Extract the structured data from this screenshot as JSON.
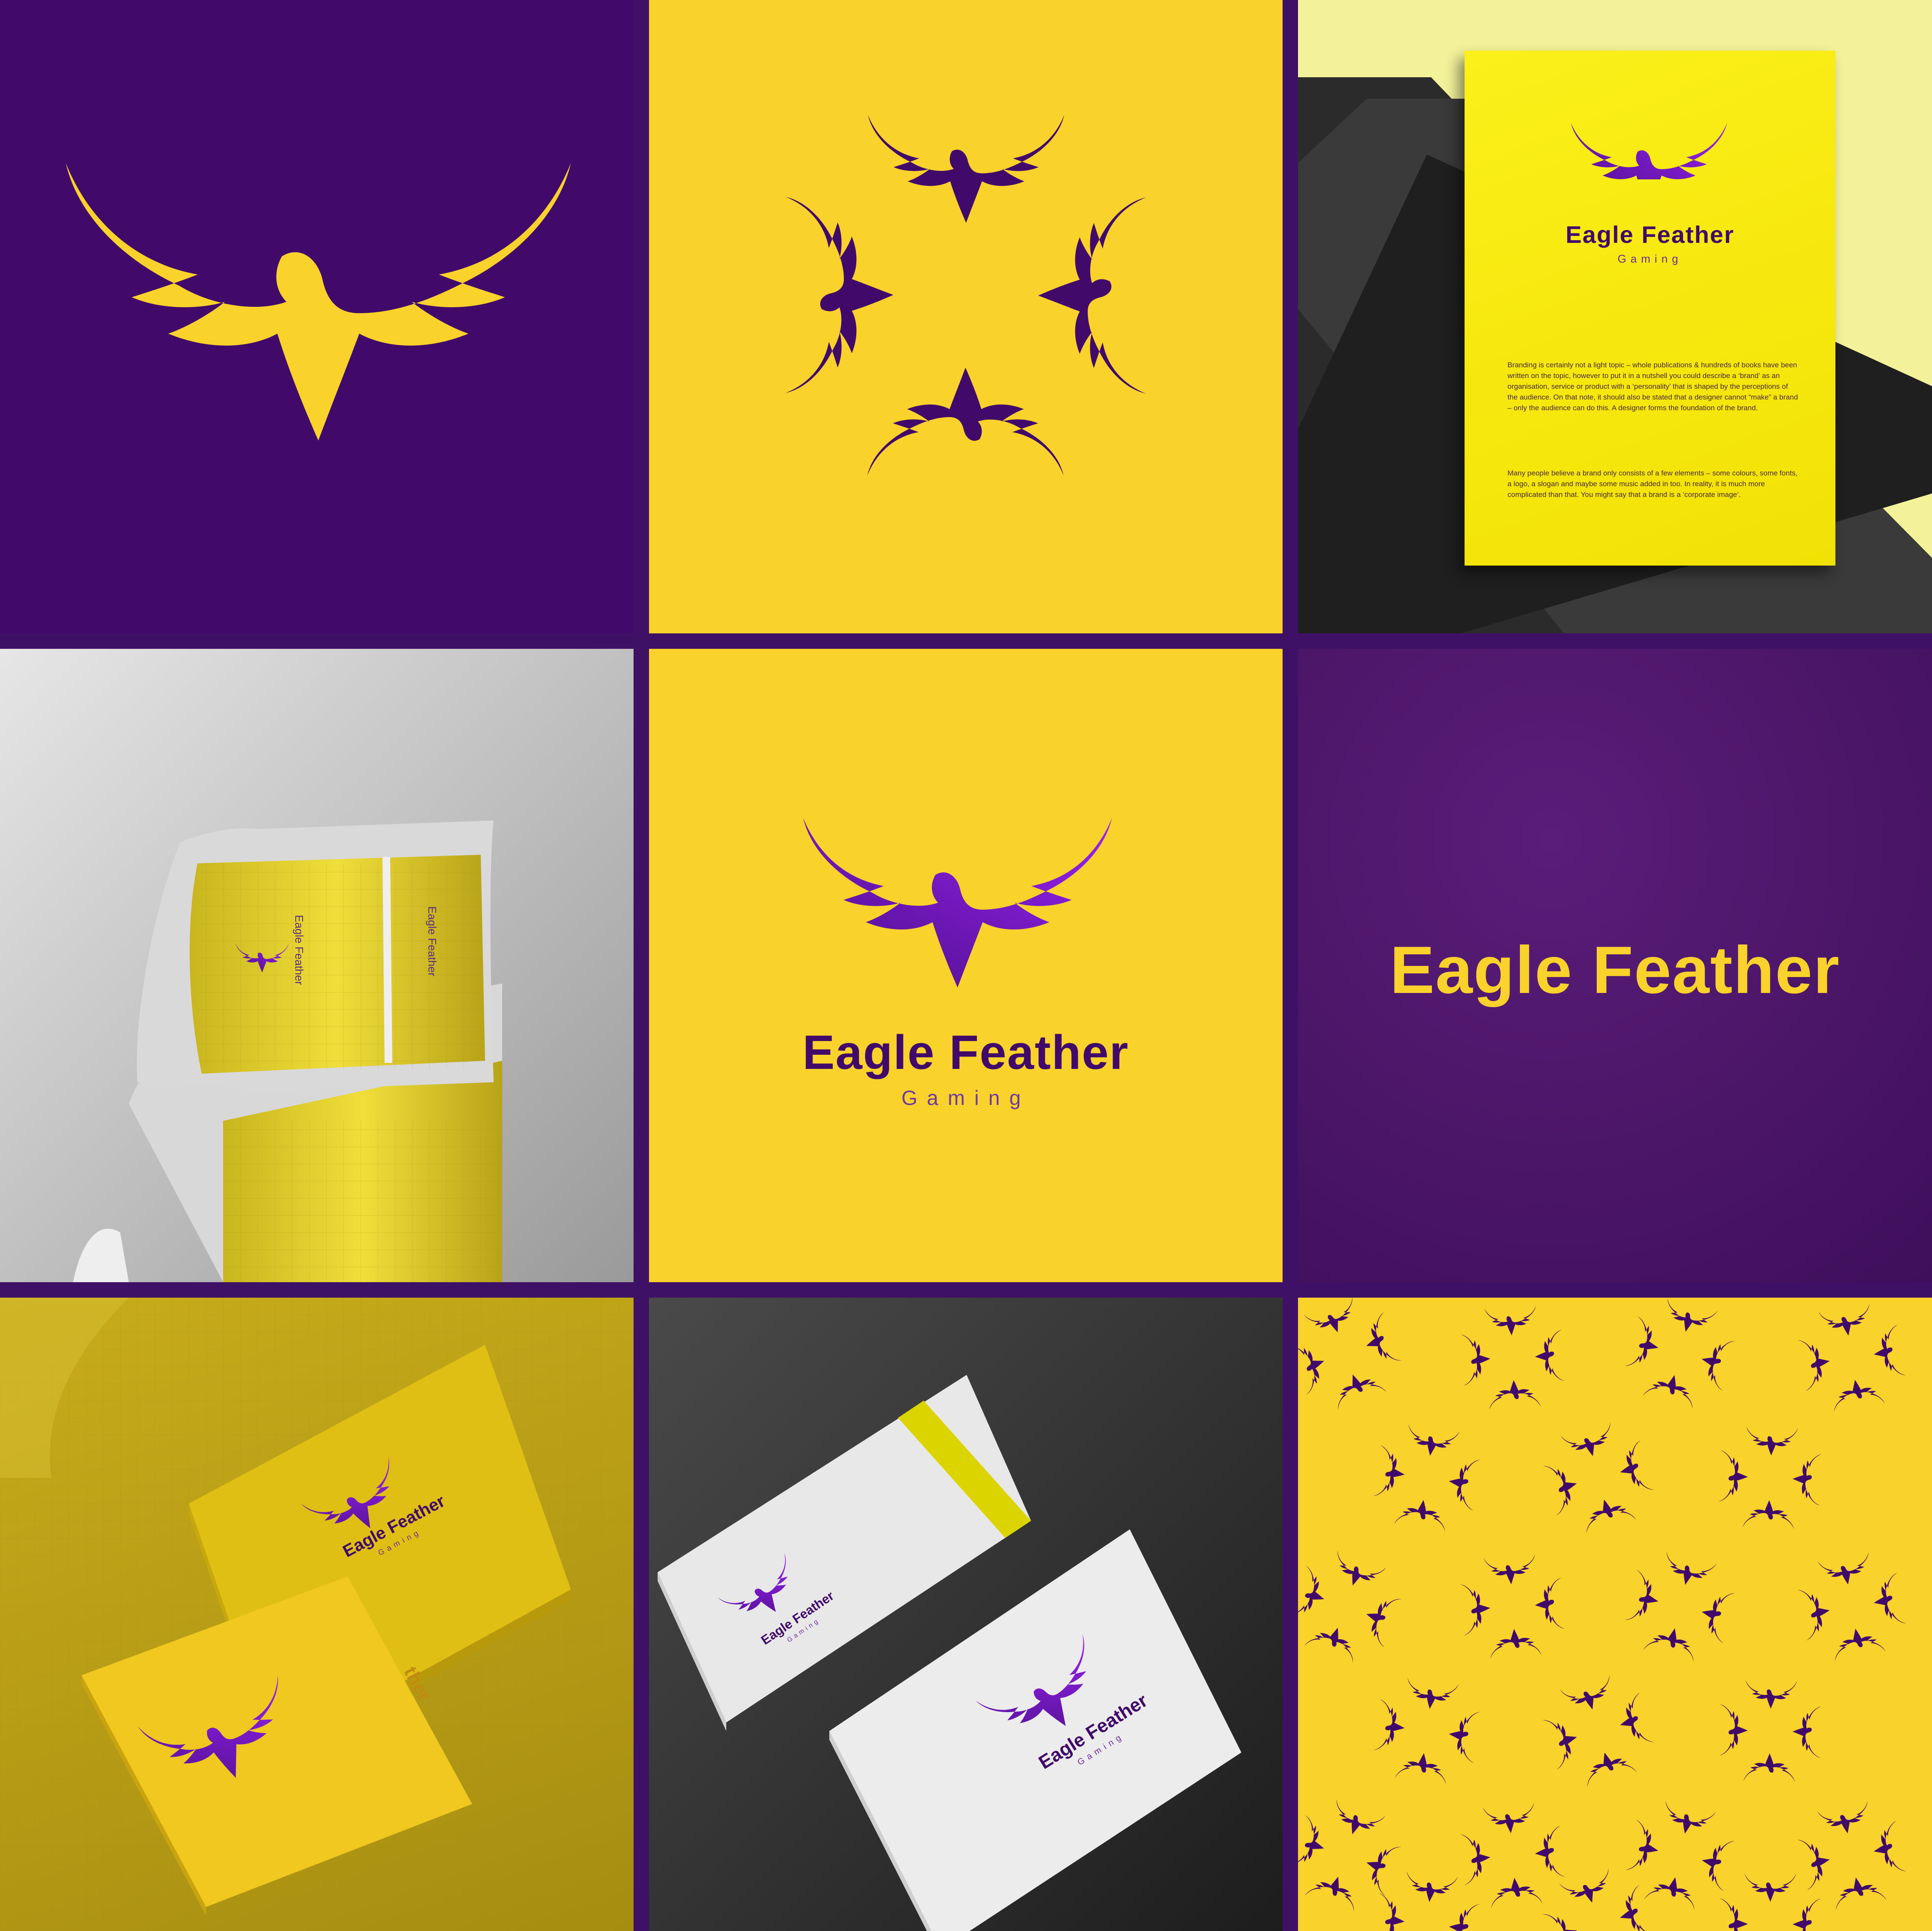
{
  "brand": {
    "name": "Eagle Feather",
    "tagline": "Gaming"
  },
  "colors": {
    "purple": "#410a6a",
    "purple_light": "#8d1ff0",
    "yellow": "#f9d22b",
    "lemon": "#f7e70a",
    "dark_gold": "#b59c14",
    "paper_white": "#eeeeee",
    "charcoal": "#2c2c2c"
  },
  "letterhead": {
    "paragraph_1": "Branding is certainly not a light topic – whole publications & hundreds of books have been written on the topic, however to put it in a nutshell you could describe a ‘brand’ as an organisation, service or product with a ‘personality’ that is shaped by the perceptions of the audience. On that note, it should also be stated that a designer cannot “make” a brand – only the audience can do this. A designer forms the foundation of the brand.",
    "paragraph_2": "Many people believe a brand only consists of a few elements – some colours, some fonts, a logo, a slogan and maybe some music added in too. In reality, it is much more complicated than that. You might say that a brand is a ‘corporate image’."
  },
  "card_back_fragment": "ther",
  "icons": [
    "eagle-logo-icon"
  ]
}
